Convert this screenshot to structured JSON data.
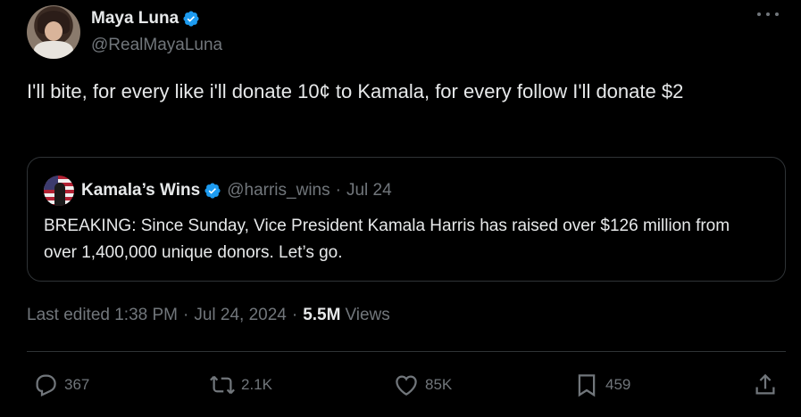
{
  "author": {
    "display_name": "Maya Luna",
    "handle": "@RealMayaLuna",
    "verified_color": "#1d9bf0"
  },
  "tweet": {
    "text": "I'll bite, for every like i'll donate 10¢ to Kamala, for every follow I'll donate $2"
  },
  "quote": {
    "display_name": "Kamala’s Wins",
    "handle": "@harris_wins",
    "separator": "·",
    "date": "Jul 24",
    "text": "BREAKING: Since Sunday, Vice President Kamala Harris has raised over $126 million from over 1,400,000 unique donors. Let’s go."
  },
  "meta": {
    "edited": "Last edited 1:38 PM",
    "separator": "·",
    "date": "Jul 24, 2024",
    "separator2": "·",
    "views_count": "5.5M",
    "views_label": "Views"
  },
  "actions": {
    "replies": "367",
    "reposts": "2.1K",
    "likes": "85K",
    "bookmarks": "459"
  },
  "icons": {
    "more": "more-icon",
    "verified": "verified-badge-icon",
    "reply": "reply-icon",
    "repost": "repost-icon",
    "like": "heart-icon",
    "bookmark": "bookmark-icon",
    "share": "share-icon"
  }
}
